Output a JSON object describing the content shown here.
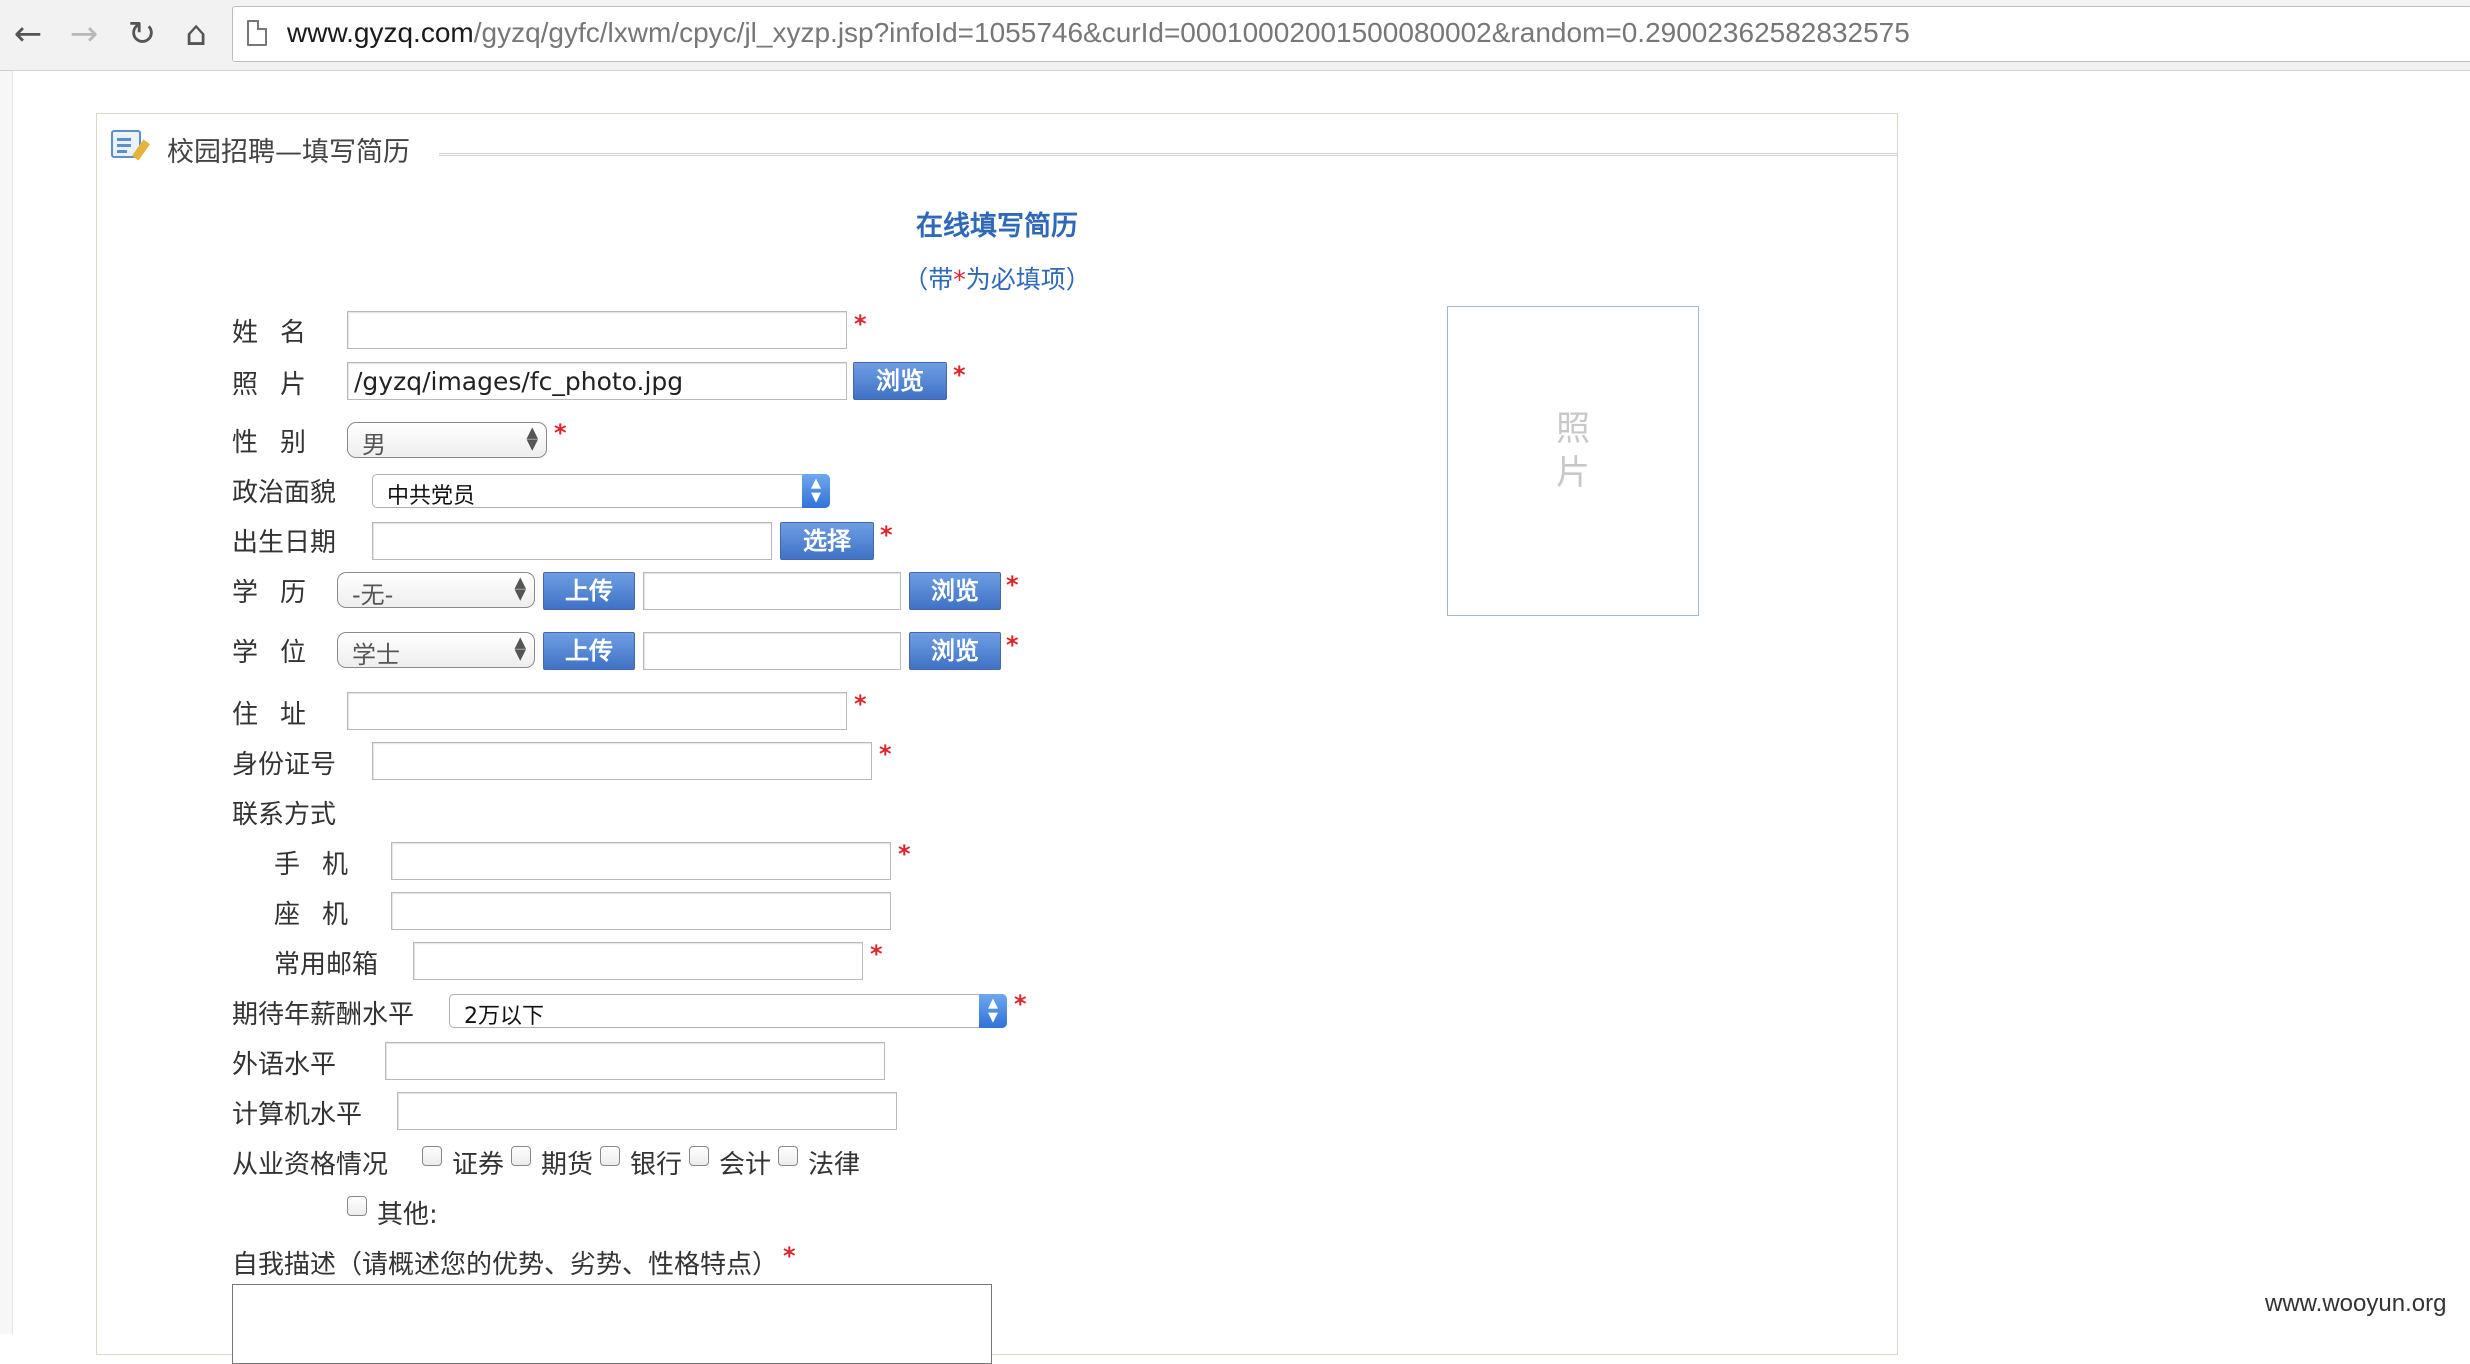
{
  "browser": {
    "url_host": "www.gyzq.com",
    "url_path": "/gyzq/gyfc/lxwm/cpyc/jl_xyzp.jsp?infoId=1055746&curId=00010002001500080002&random=0.29002362582832575"
  },
  "panel": {
    "title": "校园招聘—填写简历",
    "form_title": "在线填写简历",
    "note_prefix": "（带",
    "note_star": "*",
    "note_suffix": "为必填项）"
  },
  "form": {
    "name_label": "姓名",
    "photo_label": "照片",
    "photo_value": "/gyzq/images/fc_photo.jpg",
    "browse_label": "浏览",
    "gender_label": "性别",
    "gender_value": "男",
    "politics_label": "政治面貌",
    "politics_value": "中共党员",
    "birth_label": "出生日期",
    "choose_label": "选择",
    "education_label": "学历",
    "education_value": "-无-",
    "upload_label": "上传",
    "degree_label": "学位",
    "degree_value": "学士",
    "address_label": "住址",
    "id_label": "身份证号",
    "contact_label": "联系方式",
    "mobile_label": "手机",
    "landline_label": "座机",
    "email_label": "常用邮箱",
    "salary_label": "期待年薪酬水平",
    "salary_value": "2万以下",
    "language_label": "外语水平",
    "computer_label": "计算机水平",
    "qualification_label": "从业资格情况",
    "qualifications": [
      "证券",
      "期货",
      "银行",
      "会计",
      "法律"
    ],
    "other_label": "其他:",
    "self_desc_label": "自我描述（请概述您的优势、劣势、性格特点）",
    "required_star": "*"
  },
  "photo_placeholder": {
    "line1": "照",
    "line2": "片"
  },
  "watermark": "www.wooyun.org",
  "colors": {
    "link_blue": "#2f68b8",
    "required_red": "#e0222a",
    "button_blue": "#3f72c6"
  }
}
